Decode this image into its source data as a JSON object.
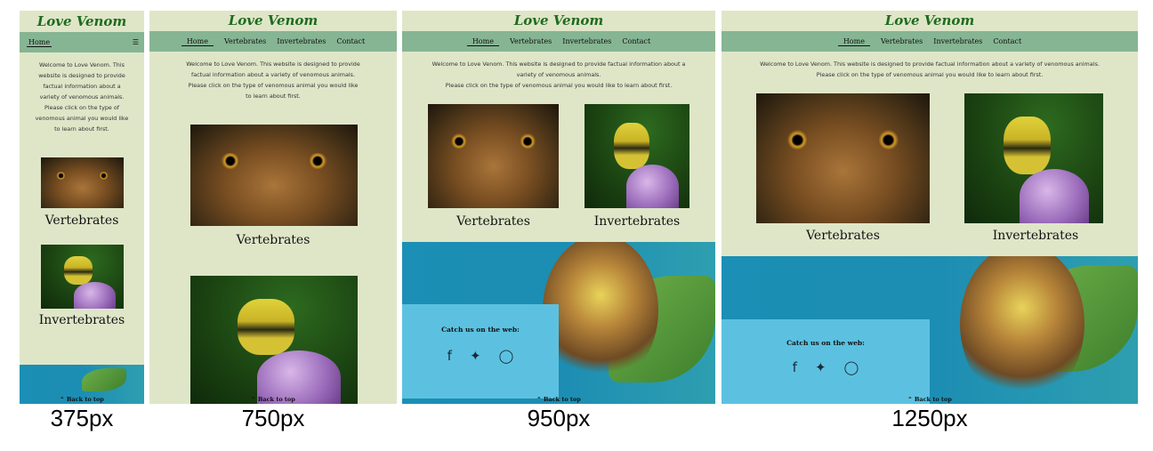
{
  "site": {
    "logo": "Love Venom",
    "nav": {
      "home": "Home",
      "vertebrates": "Vertebrates",
      "invertebrates": "Invertebrates",
      "contact": "Contact"
    },
    "welcome_1": "Welcome to Love Venom. This website is designed to provide factual information about a variety of venomous animals.",
    "welcome_2": "Please click on the type of venomous animal you would like to learn about first.",
    "vertebrates_caption": "Vertebrates",
    "invertebrates_caption": "Invertebrates",
    "catch_us": "Catch us on the web:",
    "back_to_top": "Back to top"
  },
  "icons": {
    "menu": "hamburger-icon",
    "facebook": "facebook-icon",
    "twitter": "twitter-icon",
    "instagram": "instagram-icon",
    "back_to_top": "double-chevron-up-icon"
  },
  "colors": {
    "page_bg": "#dfe6c8",
    "nav_bg": "#86b593",
    "logo": "#1f6b1f",
    "hero_blue": "#1b8fb5",
    "social_box": "#5cc1e0"
  },
  "breakpoint_labels": [
    "375px",
    "750px",
    "950px",
    "1250px"
  ]
}
